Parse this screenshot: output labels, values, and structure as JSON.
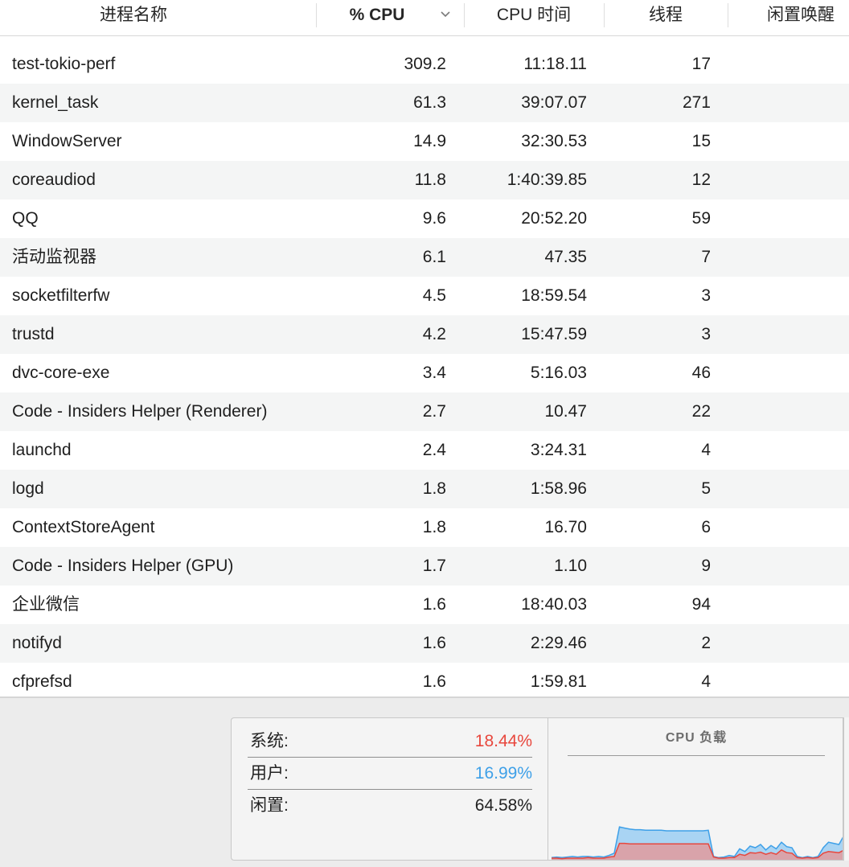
{
  "header": {
    "col_name": "进程名称",
    "col_cpu": "% CPU",
    "col_time": "CPU 时间",
    "col_threads": "线程",
    "col_idle": "闲置唤醒"
  },
  "processes": [
    {
      "name": "test-tokio-perf",
      "cpu": "309.2",
      "time": "11:18.11",
      "threads": "17"
    },
    {
      "name": "kernel_task",
      "cpu": "61.3",
      "time": "39:07.07",
      "threads": "271"
    },
    {
      "name": "WindowServer",
      "cpu": "14.9",
      "time": "32:30.53",
      "threads": "15"
    },
    {
      "name": "coreaudiod",
      "cpu": "11.8",
      "time": "1:40:39.85",
      "threads": "12"
    },
    {
      "name": "QQ",
      "cpu": "9.6",
      "time": "20:52.20",
      "threads": "59"
    },
    {
      "name": "活动监视器",
      "cpu": "6.1",
      "time": "47.35",
      "threads": "7"
    },
    {
      "name": "socketfilterfw",
      "cpu": "4.5",
      "time": "18:59.54",
      "threads": "3"
    },
    {
      "name": "trustd",
      "cpu": "4.2",
      "time": "15:47.59",
      "threads": "3"
    },
    {
      "name": "dvc-core-exe",
      "cpu": "3.4",
      "time": "5:16.03",
      "threads": "46"
    },
    {
      "name": "Code - Insiders Helper (Renderer)",
      "cpu": "2.7",
      "time": "10.47",
      "threads": "22"
    },
    {
      "name": "launchd",
      "cpu": "2.4",
      "time": "3:24.31",
      "threads": "4"
    },
    {
      "name": "logd",
      "cpu": "1.8",
      "time": "1:58.96",
      "threads": "5"
    },
    {
      "name": "ContextStoreAgent",
      "cpu": "1.8",
      "time": "16.70",
      "threads": "6"
    },
    {
      "name": "Code - Insiders Helper (GPU)",
      "cpu": "1.7",
      "time": "1.10",
      "threads": "9"
    },
    {
      "name": "企业微信",
      "cpu": "1.6",
      "time": "18:40.03",
      "threads": "94"
    },
    {
      "name": "notifyd",
      "cpu": "1.6",
      "time": "2:29.46",
      "threads": "2"
    },
    {
      "name": "cfprefsd",
      "cpu": "1.6",
      "time": "1:59.81",
      "threads": "4"
    }
  ],
  "stats": {
    "system_label": "系统:",
    "system_value": "18.44%",
    "user_label": "用户:",
    "user_value": "16.99%",
    "idle_label": "闲置:",
    "idle_value": "64.58%"
  },
  "graph": {
    "title": "CPU 负载",
    "system_color": "#e8473d",
    "user_color": "#3ea0e8",
    "system_fill": "#d9a3aa",
    "user_fill": "#a9d4f3",
    "system_load": [
      3,
      3,
      2,
      3,
      3,
      3,
      3,
      4,
      3,
      3,
      3,
      5,
      6,
      30,
      30,
      29,
      29,
      29,
      29,
      29,
      29,
      29,
      29,
      29,
      29,
      29,
      29,
      29,
      29,
      29,
      29,
      5,
      3,
      3,
      4,
      4,
      10,
      8,
      13,
      12,
      14,
      10,
      13,
      10,
      18,
      13,
      12,
      4,
      3,
      4,
      3,
      4,
      12,
      15,
      14,
      13,
      18
    ],
    "user_load": [
      4,
      5,
      4,
      5,
      6,
      5,
      6,
      6,
      5,
      6,
      5,
      8,
      12,
      60,
      58,
      56,
      55,
      55,
      54,
      54,
      54,
      54,
      53,
      53,
      53,
      53,
      53,
      53,
      53,
      53,
      54,
      6,
      4,
      5,
      8,
      6,
      20,
      15,
      25,
      22,
      28,
      18,
      26,
      20,
      32,
      24,
      22,
      6,
      4,
      6,
      4,
      6,
      22,
      32,
      30,
      28,
      45
    ]
  }
}
